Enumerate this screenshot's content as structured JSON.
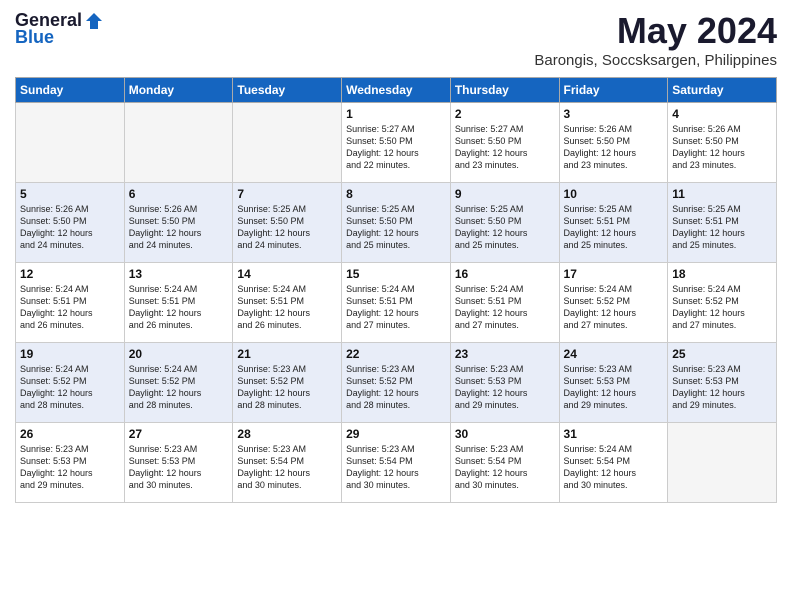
{
  "header": {
    "logo_general": "General",
    "logo_blue": "Blue",
    "title": "May 2024",
    "subtitle": "Barongis, Soccsksargen, Philippines"
  },
  "days_of_week": [
    "Sunday",
    "Monday",
    "Tuesday",
    "Wednesday",
    "Thursday",
    "Friday",
    "Saturday"
  ],
  "weeks": [
    {
      "shaded": false,
      "days": [
        {
          "num": "",
          "info": ""
        },
        {
          "num": "",
          "info": ""
        },
        {
          "num": "",
          "info": ""
        },
        {
          "num": "1",
          "info": "Sunrise: 5:27 AM\nSunset: 5:50 PM\nDaylight: 12 hours\nand 22 minutes."
        },
        {
          "num": "2",
          "info": "Sunrise: 5:27 AM\nSunset: 5:50 PM\nDaylight: 12 hours\nand 23 minutes."
        },
        {
          "num": "3",
          "info": "Sunrise: 5:26 AM\nSunset: 5:50 PM\nDaylight: 12 hours\nand 23 minutes."
        },
        {
          "num": "4",
          "info": "Sunrise: 5:26 AM\nSunset: 5:50 PM\nDaylight: 12 hours\nand 23 minutes."
        }
      ]
    },
    {
      "shaded": true,
      "days": [
        {
          "num": "5",
          "info": "Sunrise: 5:26 AM\nSunset: 5:50 PM\nDaylight: 12 hours\nand 24 minutes."
        },
        {
          "num": "6",
          "info": "Sunrise: 5:26 AM\nSunset: 5:50 PM\nDaylight: 12 hours\nand 24 minutes."
        },
        {
          "num": "7",
          "info": "Sunrise: 5:25 AM\nSunset: 5:50 PM\nDaylight: 12 hours\nand 24 minutes."
        },
        {
          "num": "8",
          "info": "Sunrise: 5:25 AM\nSunset: 5:50 PM\nDaylight: 12 hours\nand 25 minutes."
        },
        {
          "num": "9",
          "info": "Sunrise: 5:25 AM\nSunset: 5:50 PM\nDaylight: 12 hours\nand 25 minutes."
        },
        {
          "num": "10",
          "info": "Sunrise: 5:25 AM\nSunset: 5:51 PM\nDaylight: 12 hours\nand 25 minutes."
        },
        {
          "num": "11",
          "info": "Sunrise: 5:25 AM\nSunset: 5:51 PM\nDaylight: 12 hours\nand 25 minutes."
        }
      ]
    },
    {
      "shaded": false,
      "days": [
        {
          "num": "12",
          "info": "Sunrise: 5:24 AM\nSunset: 5:51 PM\nDaylight: 12 hours\nand 26 minutes."
        },
        {
          "num": "13",
          "info": "Sunrise: 5:24 AM\nSunset: 5:51 PM\nDaylight: 12 hours\nand 26 minutes."
        },
        {
          "num": "14",
          "info": "Sunrise: 5:24 AM\nSunset: 5:51 PM\nDaylight: 12 hours\nand 26 minutes."
        },
        {
          "num": "15",
          "info": "Sunrise: 5:24 AM\nSunset: 5:51 PM\nDaylight: 12 hours\nand 27 minutes."
        },
        {
          "num": "16",
          "info": "Sunrise: 5:24 AM\nSunset: 5:51 PM\nDaylight: 12 hours\nand 27 minutes."
        },
        {
          "num": "17",
          "info": "Sunrise: 5:24 AM\nSunset: 5:52 PM\nDaylight: 12 hours\nand 27 minutes."
        },
        {
          "num": "18",
          "info": "Sunrise: 5:24 AM\nSunset: 5:52 PM\nDaylight: 12 hours\nand 27 minutes."
        }
      ]
    },
    {
      "shaded": true,
      "days": [
        {
          "num": "19",
          "info": "Sunrise: 5:24 AM\nSunset: 5:52 PM\nDaylight: 12 hours\nand 28 minutes."
        },
        {
          "num": "20",
          "info": "Sunrise: 5:24 AM\nSunset: 5:52 PM\nDaylight: 12 hours\nand 28 minutes."
        },
        {
          "num": "21",
          "info": "Sunrise: 5:23 AM\nSunset: 5:52 PM\nDaylight: 12 hours\nand 28 minutes."
        },
        {
          "num": "22",
          "info": "Sunrise: 5:23 AM\nSunset: 5:52 PM\nDaylight: 12 hours\nand 28 minutes."
        },
        {
          "num": "23",
          "info": "Sunrise: 5:23 AM\nSunset: 5:53 PM\nDaylight: 12 hours\nand 29 minutes."
        },
        {
          "num": "24",
          "info": "Sunrise: 5:23 AM\nSunset: 5:53 PM\nDaylight: 12 hours\nand 29 minutes."
        },
        {
          "num": "25",
          "info": "Sunrise: 5:23 AM\nSunset: 5:53 PM\nDaylight: 12 hours\nand 29 minutes."
        }
      ]
    },
    {
      "shaded": false,
      "days": [
        {
          "num": "26",
          "info": "Sunrise: 5:23 AM\nSunset: 5:53 PM\nDaylight: 12 hours\nand 29 minutes."
        },
        {
          "num": "27",
          "info": "Sunrise: 5:23 AM\nSunset: 5:53 PM\nDaylight: 12 hours\nand 30 minutes."
        },
        {
          "num": "28",
          "info": "Sunrise: 5:23 AM\nSunset: 5:54 PM\nDaylight: 12 hours\nand 30 minutes."
        },
        {
          "num": "29",
          "info": "Sunrise: 5:23 AM\nSunset: 5:54 PM\nDaylight: 12 hours\nand 30 minutes."
        },
        {
          "num": "30",
          "info": "Sunrise: 5:23 AM\nSunset: 5:54 PM\nDaylight: 12 hours\nand 30 minutes."
        },
        {
          "num": "31",
          "info": "Sunrise: 5:24 AM\nSunset: 5:54 PM\nDaylight: 12 hours\nand 30 minutes."
        },
        {
          "num": "",
          "info": ""
        }
      ]
    }
  ]
}
